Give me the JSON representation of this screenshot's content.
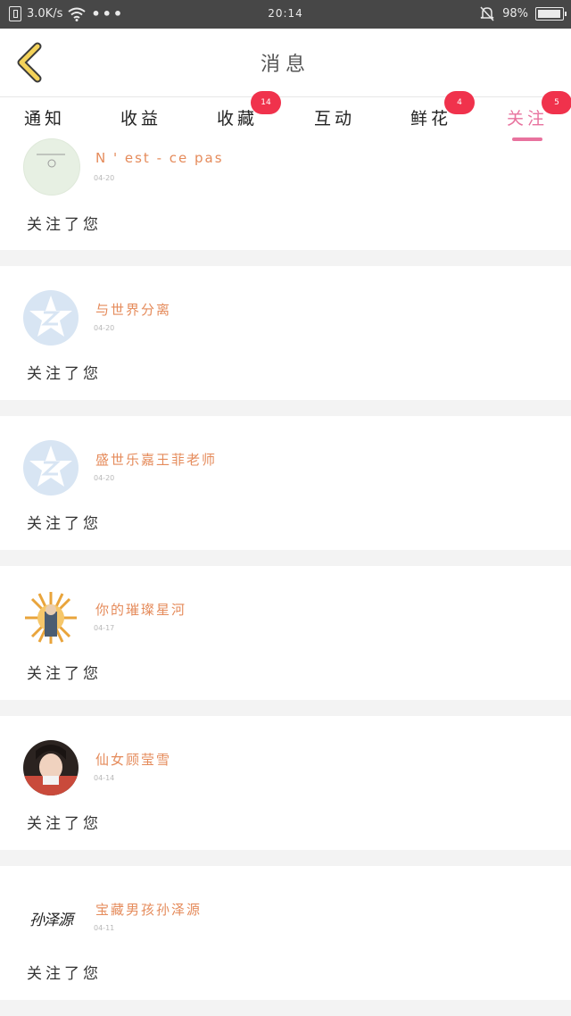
{
  "status_bar": {
    "network_speed": "3.0K/s",
    "more": "•••",
    "time": "20:14",
    "battery": "98%"
  },
  "header": {
    "title": "消息"
  },
  "tabs": [
    {
      "label": "通知",
      "badge": null,
      "active": false
    },
    {
      "label": "收益",
      "badge": null,
      "active": false
    },
    {
      "label": "收藏",
      "badge": "14",
      "active": false
    },
    {
      "label": "互动",
      "badge": null,
      "active": false
    },
    {
      "label": "鲜花",
      "badge": "4",
      "active": false
    },
    {
      "label": "关注",
      "badge": "5",
      "active": true
    }
  ],
  "feed": [
    {
      "name": "N ' est - ce pas",
      "date": "04-20",
      "action": "关注了您",
      "avatar": "cup-icon"
    },
    {
      "name": "与世界分离",
      "date": "04-20",
      "action": "关注了您",
      "avatar": "qzone-star-icon"
    },
    {
      "name": "盛世乐嘉王菲老师",
      "date": "04-20",
      "action": "关注了您",
      "avatar": "qzone-star-icon"
    },
    {
      "name": "你的璀璨星河",
      "date": "04-17",
      "action": "关注了您",
      "avatar": "sun-portrait-icon"
    },
    {
      "name": "仙女顾莹雪",
      "date": "04-14",
      "action": "关注了您",
      "avatar": "girl-photo-icon"
    },
    {
      "name": "宝藏男孩孙泽源",
      "date": "04-11",
      "action": "关注了您",
      "avatar": "signature-icon",
      "avatar_text": "孙泽源"
    }
  ],
  "colors": {
    "accent": "#e8729e",
    "badge": "#f0324c",
    "username": "#e58b5b",
    "back_arrow": "#f4d35a"
  }
}
